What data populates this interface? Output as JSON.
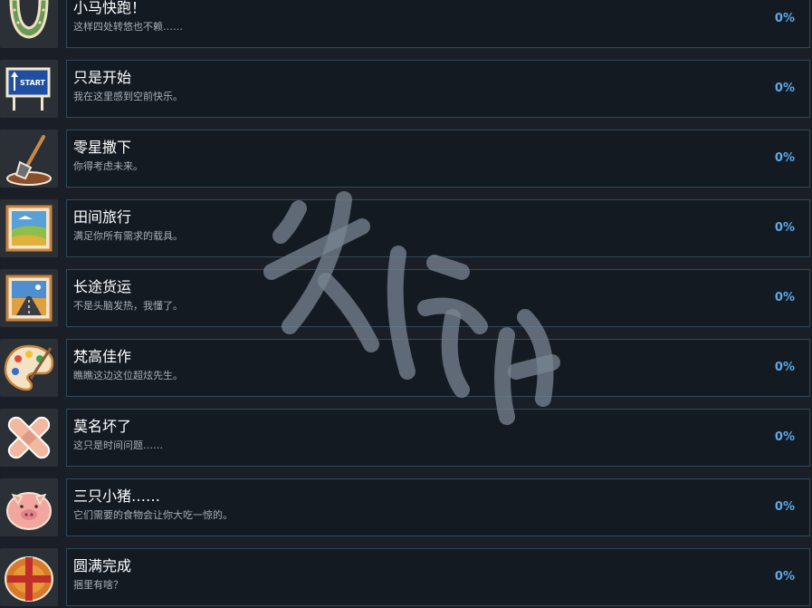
{
  "achievements": [
    {
      "title": "小马快跑！",
      "description": "这样四处转悠也不赖……",
      "percent": "0%",
      "icon": "horseshoe-icon"
    },
    {
      "title": "只是开始",
      "description": "我在这里感到空前快乐。",
      "percent": "0%",
      "icon": "start-sign-icon",
      "icon_text": "START"
    },
    {
      "title": "零星撒下",
      "description": "你得考虑未来。",
      "percent": "0%",
      "icon": "shovel-icon"
    },
    {
      "title": "田间旅行",
      "description": "满足你所有需求的载具。",
      "percent": "0%",
      "icon": "field-picture-icon"
    },
    {
      "title": "长途货运",
      "description": "不是头脑发热，我懂了。",
      "percent": "0%",
      "icon": "road-picture-icon"
    },
    {
      "title": "梵高佳作",
      "description": "瞧瞧这边这位超炫先生。",
      "percent": "0%",
      "icon": "paint-palette-icon"
    },
    {
      "title": "莫名坏了",
      "description": "这只是时间问题……",
      "percent": "0%",
      "icon": "bandage-icon"
    },
    {
      "title": "三只小猪……",
      "description": "它们需要的食物会让你大吃一惊的。",
      "percent": "0%",
      "icon": "pig-icon"
    },
    {
      "title": "圆满完成",
      "description": "捆里有啥？",
      "percent": "0%",
      "icon": "hay-bale-icon"
    }
  ],
  "colors": {
    "card_bg": "#131a22",
    "card_border": "#2e4a5b",
    "percent": "#5fa8e8",
    "watermark": "#7a8693"
  },
  "watermark": {
    "icon": "watermark-icon"
  }
}
